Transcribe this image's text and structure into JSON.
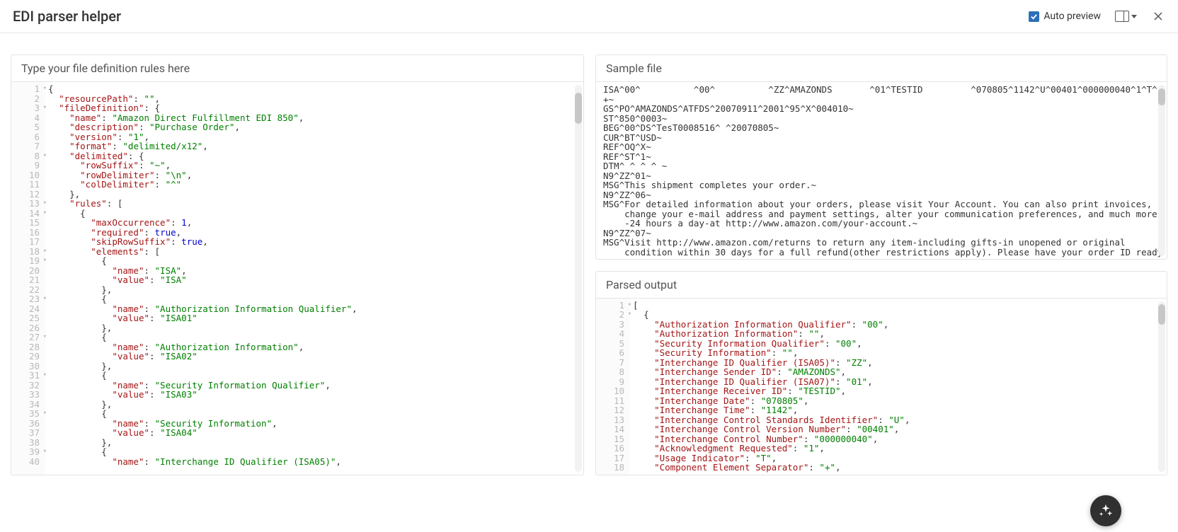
{
  "header": {
    "title": "EDI parser helper",
    "auto_preview_label": "Auto preview"
  },
  "left_panel": {
    "title": "Type your file definition rules here",
    "lines": [
      {
        "no": "1",
        "fold": true,
        "ind": 0,
        "tok": [
          {
            "t": "{",
            "c": "p"
          }
        ]
      },
      {
        "no": "2",
        "ind": 1,
        "tok": [
          {
            "t": "\"resourcePath\"",
            "c": "k"
          },
          {
            "t": ": ",
            "c": "p"
          },
          {
            "t": "\"\"",
            "c": "s"
          },
          {
            "t": ",",
            "c": "p"
          }
        ]
      },
      {
        "no": "3",
        "fold": true,
        "ind": 1,
        "tok": [
          {
            "t": "\"fileDefinition\"",
            "c": "k"
          },
          {
            "t": ": {",
            "c": "p"
          }
        ]
      },
      {
        "no": "4",
        "ind": 2,
        "tok": [
          {
            "t": "\"name\"",
            "c": "k"
          },
          {
            "t": ": ",
            "c": "p"
          },
          {
            "t": "\"Amazon Direct Fulfillment EDI 850\"",
            "c": "s"
          },
          {
            "t": ",",
            "c": "p"
          }
        ]
      },
      {
        "no": "5",
        "ind": 2,
        "tok": [
          {
            "t": "\"description\"",
            "c": "k"
          },
          {
            "t": ": ",
            "c": "p"
          },
          {
            "t": "\"Purchase Order\"",
            "c": "s"
          },
          {
            "t": ",",
            "c": "p"
          }
        ]
      },
      {
        "no": "6",
        "ind": 2,
        "tok": [
          {
            "t": "\"version\"",
            "c": "k"
          },
          {
            "t": ": ",
            "c": "p"
          },
          {
            "t": "\"1\"",
            "c": "s"
          },
          {
            "t": ",",
            "c": "p"
          }
        ]
      },
      {
        "no": "7",
        "ind": 2,
        "tok": [
          {
            "t": "\"format\"",
            "c": "k"
          },
          {
            "t": ": ",
            "c": "p"
          },
          {
            "t": "\"delimited/x12\"",
            "c": "s"
          },
          {
            "t": ",",
            "c": "p"
          }
        ]
      },
      {
        "no": "8",
        "fold": true,
        "ind": 2,
        "tok": [
          {
            "t": "\"delimited\"",
            "c": "k"
          },
          {
            "t": ": {",
            "c": "p"
          }
        ]
      },
      {
        "no": "9",
        "ind": 3,
        "tok": [
          {
            "t": "\"rowSuffix\"",
            "c": "k"
          },
          {
            "t": ": ",
            "c": "p"
          },
          {
            "t": "\"~\"",
            "c": "s"
          },
          {
            "t": ",",
            "c": "p"
          }
        ]
      },
      {
        "no": "10",
        "ind": 3,
        "tok": [
          {
            "t": "\"rowDelimiter\"",
            "c": "k"
          },
          {
            "t": ": ",
            "c": "p"
          },
          {
            "t": "\"\\n\"",
            "c": "s"
          },
          {
            "t": ",",
            "c": "p"
          }
        ]
      },
      {
        "no": "11",
        "ind": 3,
        "tok": [
          {
            "t": "\"colDelimiter\"",
            "c": "k"
          },
          {
            "t": ": ",
            "c": "p"
          },
          {
            "t": "\"^\"",
            "c": "s"
          }
        ]
      },
      {
        "no": "12",
        "ind": 2,
        "tok": [
          {
            "t": "},",
            "c": "p"
          }
        ]
      },
      {
        "no": "13",
        "fold": true,
        "ind": 2,
        "tok": [
          {
            "t": "\"rules\"",
            "c": "k"
          },
          {
            "t": ": [",
            "c": "p"
          }
        ]
      },
      {
        "no": "14",
        "fold": true,
        "ind": 3,
        "tok": [
          {
            "t": "{",
            "c": "p"
          }
        ]
      },
      {
        "no": "15",
        "ind": 4,
        "tok": [
          {
            "t": "\"maxOccurrence\"",
            "c": "k"
          },
          {
            "t": ": ",
            "c": "p"
          },
          {
            "t": "1",
            "c": "n"
          },
          {
            "t": ",",
            "c": "p"
          }
        ]
      },
      {
        "no": "16",
        "ind": 4,
        "tok": [
          {
            "t": "\"required\"",
            "c": "k"
          },
          {
            "t": ": ",
            "c": "p"
          },
          {
            "t": "true",
            "c": "n"
          },
          {
            "t": ",",
            "c": "p"
          }
        ]
      },
      {
        "no": "17",
        "ind": 4,
        "tok": [
          {
            "t": "\"skipRowSuffix\"",
            "c": "k"
          },
          {
            "t": ": ",
            "c": "p"
          },
          {
            "t": "true",
            "c": "n"
          },
          {
            "t": ",",
            "c": "p"
          }
        ]
      },
      {
        "no": "18",
        "fold": true,
        "ind": 4,
        "tok": [
          {
            "t": "\"elements\"",
            "c": "k"
          },
          {
            "t": ": [",
            "c": "p"
          }
        ]
      },
      {
        "no": "19",
        "fold": true,
        "ind": 5,
        "tok": [
          {
            "t": "{",
            "c": "p"
          }
        ]
      },
      {
        "no": "20",
        "ind": 6,
        "tok": [
          {
            "t": "\"name\"",
            "c": "k"
          },
          {
            "t": ": ",
            "c": "p"
          },
          {
            "t": "\"ISA\"",
            "c": "s"
          },
          {
            "t": ",",
            "c": "p"
          }
        ]
      },
      {
        "no": "21",
        "ind": 6,
        "tok": [
          {
            "t": "\"value\"",
            "c": "k"
          },
          {
            "t": ": ",
            "c": "p"
          },
          {
            "t": "\"ISA\"",
            "c": "s"
          }
        ]
      },
      {
        "no": "22",
        "ind": 5,
        "tok": [
          {
            "t": "},",
            "c": "p"
          }
        ]
      },
      {
        "no": "23",
        "fold": true,
        "ind": 5,
        "tok": [
          {
            "t": "{",
            "c": "p"
          }
        ]
      },
      {
        "no": "24",
        "ind": 6,
        "tok": [
          {
            "t": "\"name\"",
            "c": "k"
          },
          {
            "t": ": ",
            "c": "p"
          },
          {
            "t": "\"Authorization Information Qualifier\"",
            "c": "s"
          },
          {
            "t": ",",
            "c": "p"
          }
        ]
      },
      {
        "no": "25",
        "ind": 6,
        "tok": [
          {
            "t": "\"value\"",
            "c": "k"
          },
          {
            "t": ": ",
            "c": "p"
          },
          {
            "t": "\"ISA01\"",
            "c": "s"
          }
        ]
      },
      {
        "no": "26",
        "ind": 5,
        "tok": [
          {
            "t": "},",
            "c": "p"
          }
        ]
      },
      {
        "no": "27",
        "fold": true,
        "ind": 5,
        "tok": [
          {
            "t": "{",
            "c": "p"
          }
        ]
      },
      {
        "no": "28",
        "ind": 6,
        "tok": [
          {
            "t": "\"name\"",
            "c": "k"
          },
          {
            "t": ": ",
            "c": "p"
          },
          {
            "t": "\"Authorization Information\"",
            "c": "s"
          },
          {
            "t": ",",
            "c": "p"
          }
        ]
      },
      {
        "no": "29",
        "ind": 6,
        "tok": [
          {
            "t": "\"value\"",
            "c": "k"
          },
          {
            "t": ": ",
            "c": "p"
          },
          {
            "t": "\"ISA02\"",
            "c": "s"
          }
        ]
      },
      {
        "no": "30",
        "ind": 5,
        "tok": [
          {
            "t": "},",
            "c": "p"
          }
        ]
      },
      {
        "no": "31",
        "fold": true,
        "ind": 5,
        "tok": [
          {
            "t": "{",
            "c": "p"
          }
        ]
      },
      {
        "no": "32",
        "ind": 6,
        "tok": [
          {
            "t": "\"name\"",
            "c": "k"
          },
          {
            "t": ": ",
            "c": "p"
          },
          {
            "t": "\"Security Information Qualifier\"",
            "c": "s"
          },
          {
            "t": ",",
            "c": "p"
          }
        ]
      },
      {
        "no": "33",
        "ind": 6,
        "tok": [
          {
            "t": "\"value\"",
            "c": "k"
          },
          {
            "t": ": ",
            "c": "p"
          },
          {
            "t": "\"ISA03\"",
            "c": "s"
          }
        ]
      },
      {
        "no": "34",
        "ind": 5,
        "tok": [
          {
            "t": "},",
            "c": "p"
          }
        ]
      },
      {
        "no": "35",
        "fold": true,
        "ind": 5,
        "tok": [
          {
            "t": "{",
            "c": "p"
          }
        ]
      },
      {
        "no": "36",
        "ind": 6,
        "tok": [
          {
            "t": "\"name\"",
            "c": "k"
          },
          {
            "t": ": ",
            "c": "p"
          },
          {
            "t": "\"Security Information\"",
            "c": "s"
          },
          {
            "t": ",",
            "c": "p"
          }
        ]
      },
      {
        "no": "37",
        "ind": 6,
        "tok": [
          {
            "t": "\"value\"",
            "c": "k"
          },
          {
            "t": ": ",
            "c": "p"
          },
          {
            "t": "\"ISA04\"",
            "c": "s"
          }
        ]
      },
      {
        "no": "38",
        "ind": 5,
        "tok": [
          {
            "t": "},",
            "c": "p"
          }
        ]
      },
      {
        "no": "39",
        "fold": true,
        "ind": 5,
        "tok": [
          {
            "t": "{",
            "c": "p"
          }
        ]
      },
      {
        "no": "40",
        "ind": 6,
        "tok": [
          {
            "t": "\"name\"",
            "c": "k"
          },
          {
            "t": ": ",
            "c": "p"
          },
          {
            "t": "\"Interchange ID Qualifier (ISA05)\"",
            "c": "s"
          },
          {
            "t": ",",
            "c": "p"
          }
        ]
      }
    ]
  },
  "sample_panel": {
    "title": "Sample file",
    "text": "ISA^00^          ^00^          ^ZZ^AMAZONDS       ^01^TESTID         ^070805^1142^U^00401^000000040^1^T^\n+~\nGS^PO^AMAZONDS^ATFDS^20070911^2001^95^X^004010~\nST^850^0003~\nBEG^00^DS^TesT0008516^ ^20070805~\nCUR^BT^USD~\nREF^OQ^X~\nREF^ST^1~\nDTM^ ^ ^ ^ ~\nN9^ZZ^01~\nMSG^This shipment completes your order.~\nN9^ZZ^06~\nMSG^For detailed information about your orders, please visit Your Account. You can also print invoices,\n    change your e-mail address and payment settings, alter your communication preferences, and much more\n    -24 hours a day-at http://www.amazon.com/your-account.~\nN9^ZZ^07~\nMSG^Visit http://www.amazon.com/returns to return any item-including gifts-in unopened or original\n    condition within 30 days for a full refund(other restrictions apply). Please have your order ID ready"
  },
  "parsed_panel": {
    "title": "Parsed output",
    "lines": [
      {
        "no": "1",
        "fold": true,
        "ind": 0,
        "tok": [
          {
            "t": "[",
            "c": "p"
          }
        ]
      },
      {
        "no": "2",
        "fold": true,
        "ind": 1,
        "tok": [
          {
            "t": "{",
            "c": "p"
          }
        ]
      },
      {
        "no": "3",
        "ind": 2,
        "tok": [
          {
            "t": "\"Authorization Information Qualifier\"",
            "c": "k"
          },
          {
            "t": ": ",
            "c": "p"
          },
          {
            "t": "\"00\"",
            "c": "s"
          },
          {
            "t": ",",
            "c": "p"
          }
        ]
      },
      {
        "no": "4",
        "ind": 2,
        "tok": [
          {
            "t": "\"Authorization Information\"",
            "c": "k"
          },
          {
            "t": ": ",
            "c": "p"
          },
          {
            "t": "\"\"",
            "c": "s"
          },
          {
            "t": ",",
            "c": "p"
          }
        ]
      },
      {
        "no": "5",
        "ind": 2,
        "tok": [
          {
            "t": "\"Security Information Qualifier\"",
            "c": "k"
          },
          {
            "t": ": ",
            "c": "p"
          },
          {
            "t": "\"00\"",
            "c": "s"
          },
          {
            "t": ",",
            "c": "p"
          }
        ]
      },
      {
        "no": "6",
        "ind": 2,
        "tok": [
          {
            "t": "\"Security Information\"",
            "c": "k"
          },
          {
            "t": ": ",
            "c": "p"
          },
          {
            "t": "\"\"",
            "c": "s"
          },
          {
            "t": ",",
            "c": "p"
          }
        ]
      },
      {
        "no": "7",
        "ind": 2,
        "tok": [
          {
            "t": "\"Interchange ID Qualifier (ISA05)\"",
            "c": "k"
          },
          {
            "t": ": ",
            "c": "p"
          },
          {
            "t": "\"ZZ\"",
            "c": "s"
          },
          {
            "t": ",",
            "c": "p"
          }
        ]
      },
      {
        "no": "8",
        "ind": 2,
        "tok": [
          {
            "t": "\"Interchange Sender ID\"",
            "c": "k"
          },
          {
            "t": ": ",
            "c": "p"
          },
          {
            "t": "\"AMAZONDS\"",
            "c": "s"
          },
          {
            "t": ",",
            "c": "p"
          }
        ]
      },
      {
        "no": "9",
        "ind": 2,
        "tok": [
          {
            "t": "\"Interchange ID Qualifier (ISA07)\"",
            "c": "k"
          },
          {
            "t": ": ",
            "c": "p"
          },
          {
            "t": "\"01\"",
            "c": "s"
          },
          {
            "t": ",",
            "c": "p"
          }
        ]
      },
      {
        "no": "10",
        "ind": 2,
        "tok": [
          {
            "t": "\"Interchange Receiver ID\"",
            "c": "k"
          },
          {
            "t": ": ",
            "c": "p"
          },
          {
            "t": "\"TESTID\"",
            "c": "s"
          },
          {
            "t": ",",
            "c": "p"
          }
        ]
      },
      {
        "no": "11",
        "ind": 2,
        "tok": [
          {
            "t": "\"Interchange Date\"",
            "c": "k"
          },
          {
            "t": ": ",
            "c": "p"
          },
          {
            "t": "\"070805\"",
            "c": "s"
          },
          {
            "t": ",",
            "c": "p"
          }
        ]
      },
      {
        "no": "12",
        "ind": 2,
        "tok": [
          {
            "t": "\"Interchange Time\"",
            "c": "k"
          },
          {
            "t": ": ",
            "c": "p"
          },
          {
            "t": "\"1142\"",
            "c": "s"
          },
          {
            "t": ",",
            "c": "p"
          }
        ]
      },
      {
        "no": "13",
        "ind": 2,
        "tok": [
          {
            "t": "\"Interchange Control Standards Identifier\"",
            "c": "k"
          },
          {
            "t": ": ",
            "c": "p"
          },
          {
            "t": "\"U\"",
            "c": "s"
          },
          {
            "t": ",",
            "c": "p"
          }
        ]
      },
      {
        "no": "14",
        "ind": 2,
        "tok": [
          {
            "t": "\"Interchange Control Version Number\"",
            "c": "k"
          },
          {
            "t": ": ",
            "c": "p"
          },
          {
            "t": "\"00401\"",
            "c": "s"
          },
          {
            "t": ",",
            "c": "p"
          }
        ]
      },
      {
        "no": "15",
        "ind": 2,
        "tok": [
          {
            "t": "\"Interchange Control Number\"",
            "c": "k"
          },
          {
            "t": ": ",
            "c": "p"
          },
          {
            "t": "\"000000040\"",
            "c": "s"
          },
          {
            "t": ",",
            "c": "p"
          }
        ]
      },
      {
        "no": "16",
        "ind": 2,
        "tok": [
          {
            "t": "\"Acknowledgment Requested\"",
            "c": "k"
          },
          {
            "t": ": ",
            "c": "p"
          },
          {
            "t": "\"1\"",
            "c": "s"
          },
          {
            "t": ",",
            "c": "p"
          }
        ]
      },
      {
        "no": "17",
        "ind": 2,
        "tok": [
          {
            "t": "\"Usage Indicator\"",
            "c": "k"
          },
          {
            "t": ": ",
            "c": "p"
          },
          {
            "t": "\"T\"",
            "c": "s"
          },
          {
            "t": ",",
            "c": "p"
          }
        ]
      },
      {
        "no": "18",
        "ind": 2,
        "tok": [
          {
            "t": "\"Component Element Separator\"",
            "c": "k"
          },
          {
            "t": ": ",
            "c": "p"
          },
          {
            "t": "\"+\"",
            "c": "s"
          },
          {
            "t": ",",
            "c": "p"
          }
        ]
      }
    ]
  }
}
